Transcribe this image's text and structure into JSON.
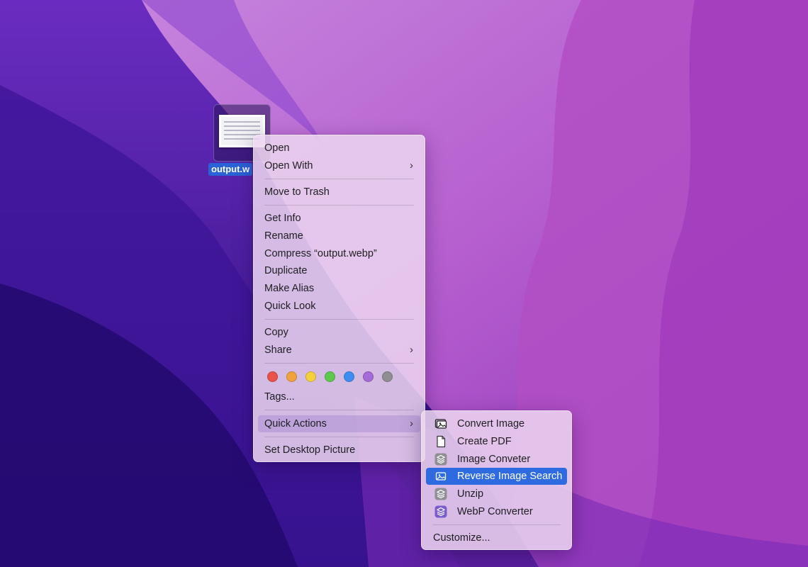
{
  "desktop": {
    "file": {
      "label": "output.w"
    }
  },
  "context_menu": {
    "open": "Open",
    "open_with": "Open With",
    "move_to_trash": "Move to Trash",
    "get_info": "Get Info",
    "rename": "Rename",
    "compress": "Compress “output.webp”",
    "duplicate": "Duplicate",
    "make_alias": "Make Alias",
    "quick_look": "Quick Look",
    "copy": "Copy",
    "share": "Share",
    "tag_colors": [
      "#e8524a",
      "#f0a33a",
      "#f2d13c",
      "#5ec84e",
      "#3d8ef0",
      "#a56bd6",
      "#8e8e93"
    ],
    "tags": "Tags...",
    "quick_actions": "Quick Actions",
    "set_desktop_picture": "Set Desktop Picture",
    "chevron": "›"
  },
  "quick_actions_menu": {
    "items": [
      {
        "label": "Convert Image",
        "icon": "images-icon"
      },
      {
        "label": "Create PDF",
        "icon": "document-icon"
      },
      {
        "label": "Image Conveter",
        "icon": "shortcuts-icon"
      },
      {
        "label": "Reverse Image Search",
        "icon": "photo-icon"
      },
      {
        "label": "Unzip",
        "icon": "shortcuts-icon"
      },
      {
        "label": "WebP Converter",
        "icon": "shortcuts-icon"
      }
    ],
    "customize": "Customize..."
  },
  "colors": {
    "selection": "#2f6be0",
    "file_label_bg": "#2a63d8"
  }
}
